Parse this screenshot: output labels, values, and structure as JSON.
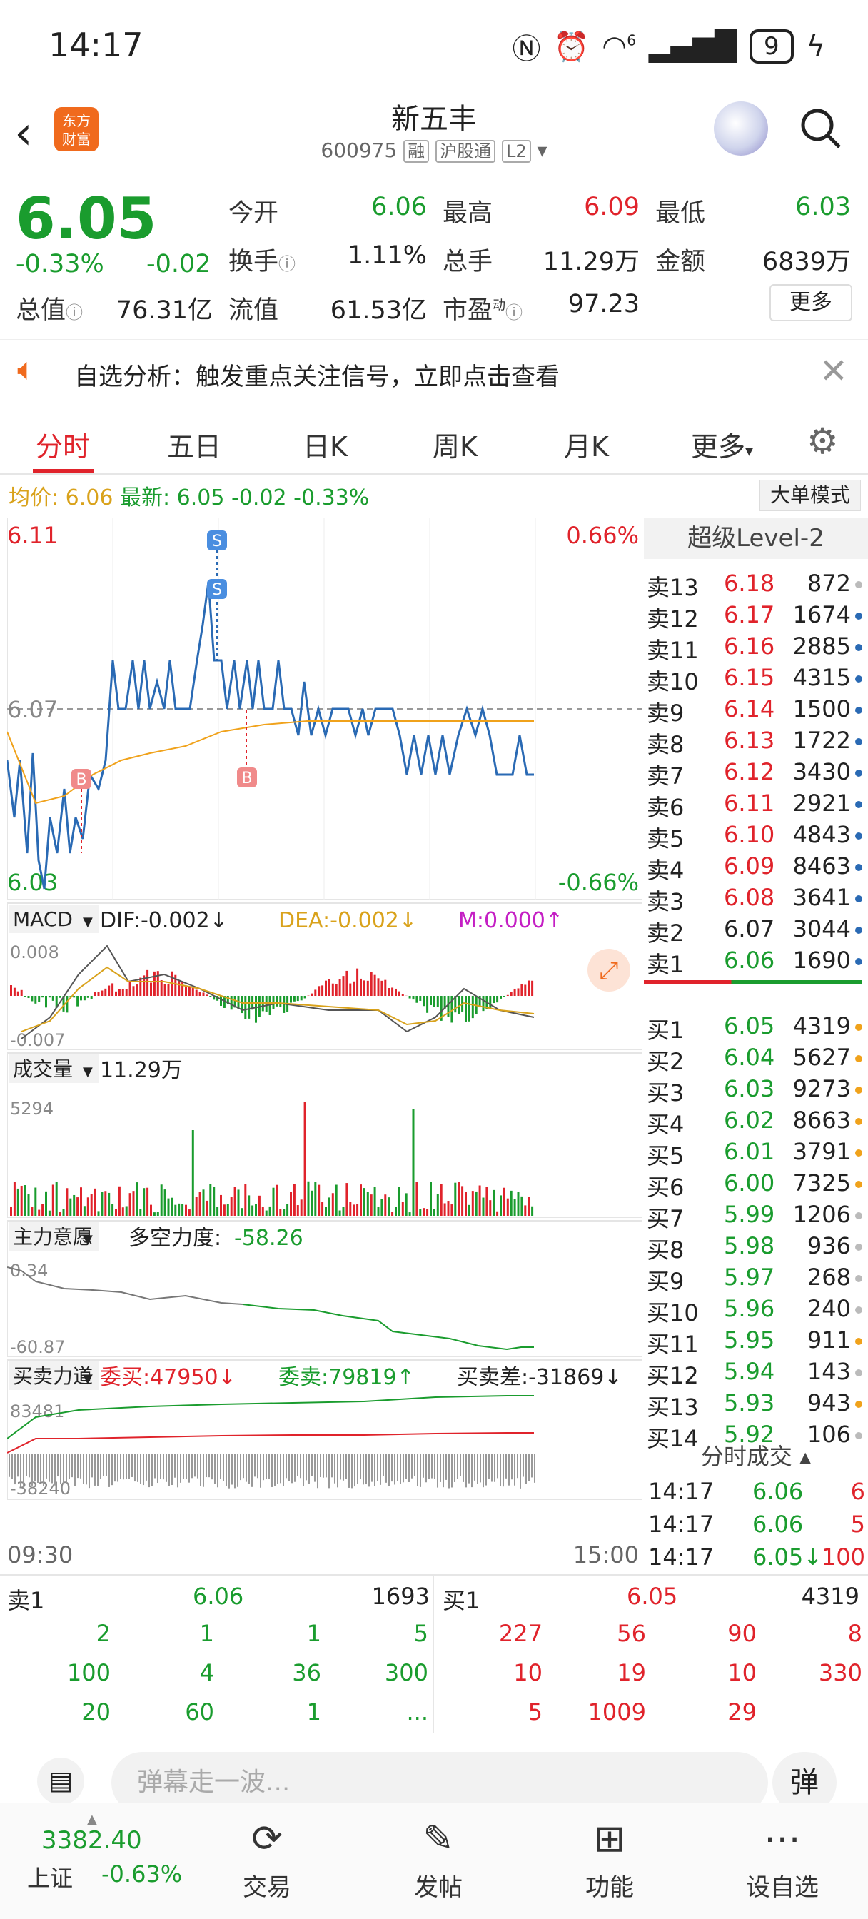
{
  "status_bar": {
    "time": "14:17",
    "battery": "9",
    "net": "6"
  },
  "header": {
    "logo_line1": "东方",
    "logo_line2": "财富",
    "name": "新五丰",
    "code": "600975",
    "tags": [
      "融",
      "沪股通",
      "L2"
    ]
  },
  "quote": {
    "price": "6.05",
    "change_pct": "-0.33%",
    "change": "-0.02",
    "fields": [
      {
        "label": "今开",
        "value": "6.06",
        "color": "green"
      },
      {
        "label": "最高",
        "value": "6.09",
        "color": "red"
      },
      {
        "label": "最低",
        "value": "6.03",
        "color": "green"
      },
      {
        "label": "换手",
        "value": "1.11%",
        "color": "dark"
      },
      {
        "label": "总手",
        "value": "11.29万",
        "color": "dark"
      },
      {
        "label": "金额",
        "value": "6839万",
        "color": "dark"
      },
      {
        "label": "总值",
        "value": "76.31亿",
        "color": "dark"
      },
      {
        "label": "流值",
        "value": "61.53亿",
        "color": "dark"
      },
      {
        "label": "市盈",
        "value": "97.23",
        "color": "dark"
      }
    ],
    "pe_superscript": "动",
    "more_label": "更多"
  },
  "notice": {
    "text": "自选分析：触发重点关注信号，立即点击查看"
  },
  "tabs": [
    "分时",
    "五日",
    "日K",
    "周K",
    "月K",
    "更多"
  ],
  "avg_bar": {
    "avg_label": "均价:",
    "avg_value": "6.06",
    "latest_label": "最新:",
    "latest_value": "6.05",
    "change": "-0.02",
    "change_pct": "-0.33%",
    "big_order_btn": "大单模式"
  },
  "price_chart": {
    "y_high": "6.11",
    "y_mid": "6.07",
    "y_low": "6.03",
    "pct_high": "0.66%",
    "pct_low": "-0.66%",
    "marker_s": "S",
    "marker_b": "B"
  },
  "macd": {
    "label": "MACD",
    "dif": "DIF:-0.002↓",
    "dea": "DEA:-0.002↓",
    "m": "M:0.000↑",
    "y_top": "0.008",
    "y_bot": "-0.007"
  },
  "volume": {
    "label": "成交量",
    "value": "11.29万",
    "y_top": "5294"
  },
  "main_force": {
    "label": "主力意愿",
    "strength_label": "多空力度:",
    "strength_value": "-58.26",
    "y_top": "0.34",
    "y_bot": "-60.87"
  },
  "buy_sell": {
    "label": "买卖力道",
    "buy": "委买:47950↓",
    "sell": "委卖:79819↑",
    "diff": "买卖差:-31869↓",
    "y_top": "83481",
    "y_bot": "-38240"
  },
  "time_axis": {
    "start": "09:30",
    "end": "15:00"
  },
  "order_book": {
    "title": "超级Level-2",
    "asks": [
      {
        "label": "卖13",
        "price": "6.18",
        "vol": "872",
        "dot": "grey"
      },
      {
        "label": "卖12",
        "price": "6.17",
        "vol": "1674",
        "dot": "blue"
      },
      {
        "label": "卖11",
        "price": "6.16",
        "vol": "2885",
        "dot": "blue"
      },
      {
        "label": "卖10",
        "price": "6.15",
        "vol": "4315",
        "dot": "blue"
      },
      {
        "label": "卖9",
        "price": "6.14",
        "vol": "1500",
        "dot": "blue"
      },
      {
        "label": "卖8",
        "price": "6.13",
        "vol": "1722",
        "dot": "blue"
      },
      {
        "label": "卖7",
        "price": "6.12",
        "vol": "3430",
        "dot": "blue"
      },
      {
        "label": "卖6",
        "price": "6.11",
        "vol": "2921",
        "dot": "blue"
      },
      {
        "label": "卖5",
        "price": "6.10",
        "vol": "4843",
        "dot": "blue"
      },
      {
        "label": "卖4",
        "price": "6.09",
        "vol": "8463",
        "dot": "blue"
      },
      {
        "label": "卖3",
        "price": "6.08",
        "vol": "3641",
        "dot": "blue"
      },
      {
        "label": "卖2",
        "price": "6.07",
        "vol": "3044",
        "dot": "blue"
      },
      {
        "label": "卖1",
        "price": "6.06",
        "vol": "1690",
        "dot": "blue"
      }
    ],
    "bids": [
      {
        "label": "买1",
        "price": "6.05",
        "vol": "4319",
        "dot": "orange"
      },
      {
        "label": "买2",
        "price": "6.04",
        "vol": "5627",
        "dot": "orange"
      },
      {
        "label": "买3",
        "price": "6.03",
        "vol": "9273",
        "dot": "orange"
      },
      {
        "label": "买4",
        "price": "6.02",
        "vol": "8663",
        "dot": "orange"
      },
      {
        "label": "买5",
        "price": "6.01",
        "vol": "3791",
        "dot": "orange"
      },
      {
        "label": "买6",
        "price": "6.00",
        "vol": "7325",
        "dot": "orange"
      },
      {
        "label": "买7",
        "price": "5.99",
        "vol": "1206",
        "dot": "grey"
      },
      {
        "label": "买8",
        "price": "5.98",
        "vol": "936",
        "dot": "grey"
      },
      {
        "label": "买9",
        "price": "5.97",
        "vol": "268",
        "dot": "grey"
      },
      {
        "label": "买10",
        "price": "5.96",
        "vol": "240",
        "dot": "grey"
      },
      {
        "label": "买11",
        "price": "5.95",
        "vol": "911",
        "dot": "orange"
      },
      {
        "label": "买12",
        "price": "5.94",
        "vol": "143",
        "dot": "grey"
      },
      {
        "label": "买13",
        "price": "5.93",
        "vol": "943",
        "dot": "orange"
      },
      {
        "label": "买14",
        "price": "5.92",
        "vol": "106",
        "dot": "grey"
      }
    ],
    "ticks_title": "分时成交",
    "ticks": [
      {
        "time": "14:17",
        "price": "6.06",
        "vol": "6"
      },
      {
        "time": "14:17",
        "price": "6.06",
        "vol": "5"
      },
      {
        "time": "14:17",
        "price": "6.05↓",
        "vol": "100"
      }
    ]
  },
  "bottom_orders": {
    "sell_label": "卖1",
    "sell_price": "6.06",
    "sell_total": "1693",
    "sell_rows": [
      [
        "2",
        "1",
        "1",
        "5"
      ],
      [
        "100",
        "4",
        "36",
        "300"
      ],
      [
        "20",
        "60",
        "1",
        "..."
      ]
    ],
    "buy_label": "买1",
    "buy_price": "6.05",
    "buy_total": "4319",
    "buy_rows": [
      [
        "227",
        "56",
        "90",
        "8"
      ],
      [
        "10",
        "19",
        "10",
        "330"
      ],
      [
        "5",
        "1009",
        "29",
        ""
      ]
    ]
  },
  "input": {
    "placeholder": "弹幕走一波...",
    "danmu_btn": "弹"
  },
  "nav": {
    "index_value": "3382.40",
    "index_name": "上证",
    "index_change": "-0.63%",
    "items": [
      "交易",
      "发帖",
      "功能",
      "设自选"
    ]
  },
  "colors": {
    "red": "#e0232b",
    "green": "#1a9c2e",
    "blue": "#2a6ab4",
    "orange": "#f0a21b",
    "gold": "#d9a21b"
  },
  "chart_data": {
    "type": "line",
    "series": [],
    "ylim": [
      6.03,
      6.11
    ]
  }
}
